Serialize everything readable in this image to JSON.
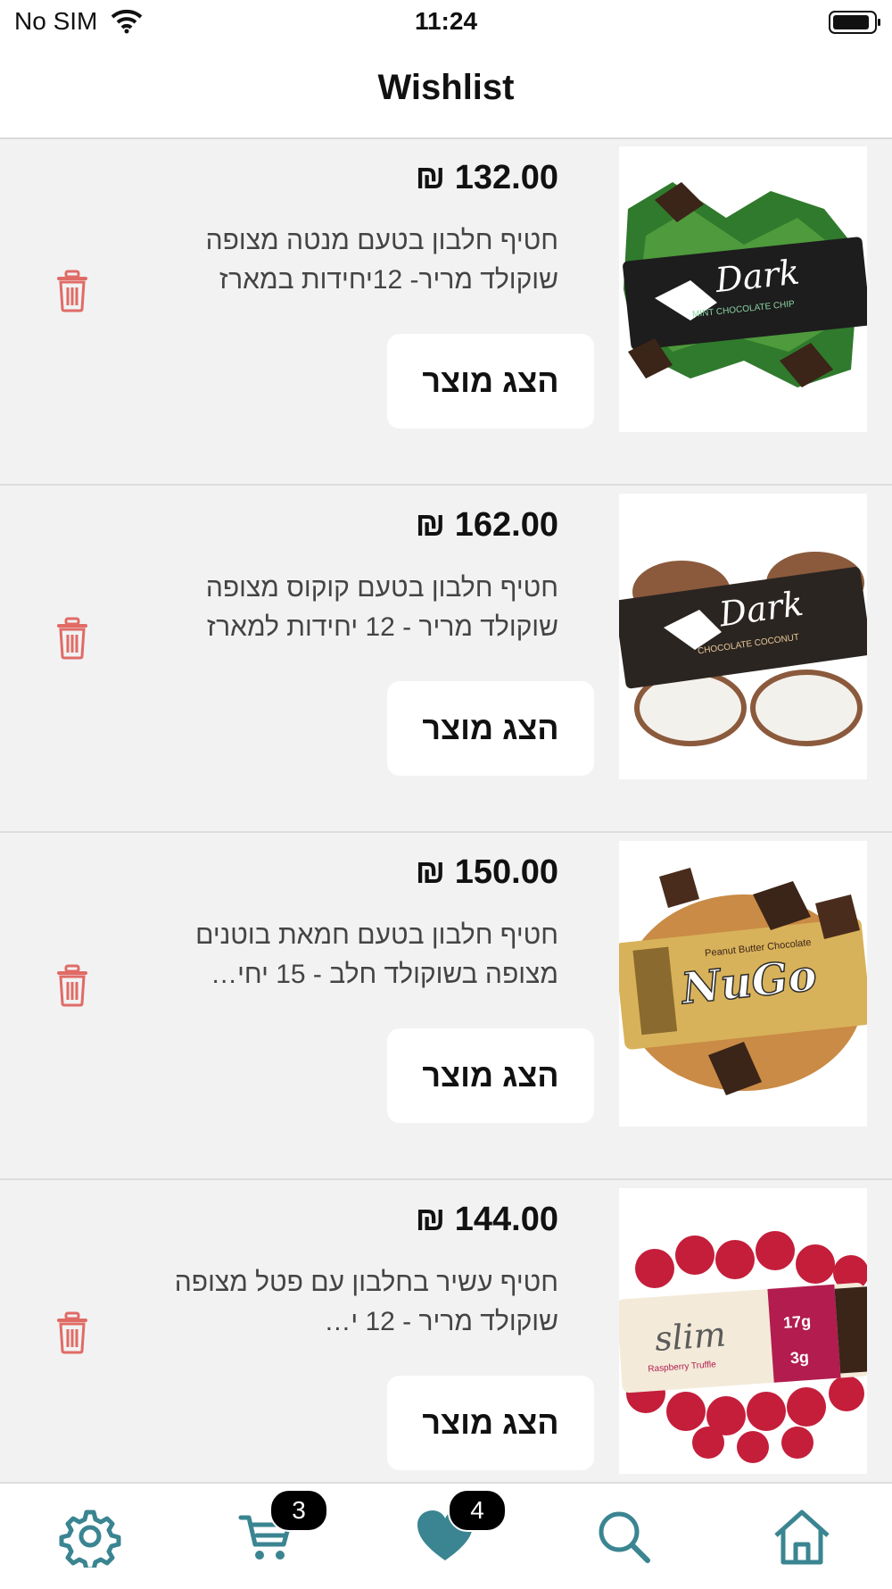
{
  "status_bar": {
    "carrier": "No SIM",
    "time": "11:24"
  },
  "header": {
    "title": "Wishlist"
  },
  "items": [
    {
      "price": "₪ 132.00",
      "description": "חטיף חלבון בטעם מנטה מצופה שוקולד מריר- 12יחידות במארז",
      "button": "הצג מוצר"
    },
    {
      "price": "₪ 162.00",
      "description": "חטיף חלבון  בטעם קוקוס מצופה שוקולד מריר - 12 יחידות למארז",
      "button": "הצג מוצר"
    },
    {
      "price": "₪ 150.00",
      "description": "חטיף חלבון בטעם חמאת בוטנים מצופה בשוקולד חלב - 15 יחי…",
      "button": "הצג מוצר"
    },
    {
      "price": "₪ 144.00",
      "description": "חטיף עשיר בחלבון  עם פטל מצופה שוקולד מריר - 12 י…",
      "button": "הצג מוצר"
    }
  ],
  "tab_bar": {
    "cart_count": "3",
    "wishlist_count": "4"
  },
  "colors": {
    "accent": "#3a8591",
    "trash": "#e06b66"
  }
}
